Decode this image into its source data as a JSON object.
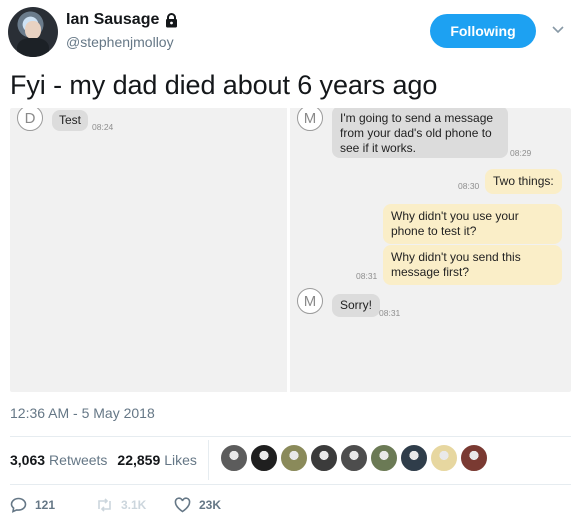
{
  "header": {
    "display_name": "Ian Sausage",
    "handle": "@stephenjmolloy",
    "follow_label": "Following",
    "follow_color": "#1da1f2",
    "lock_icon": "lock-icon",
    "menu_icon": "chevron-down-icon"
  },
  "tweet": {
    "text": "Fyi - my dad died about 6 years ago",
    "timestamp": "12:36 AM - 5 May 2018"
  },
  "media": {
    "left_panel": {
      "avatar_letter": "D",
      "message": "Test",
      "time": "08:24"
    },
    "right_panel": {
      "avatar_letter": "M",
      "incoming_1": "I'm going to send a message from your dad's old phone to see if it works.",
      "incoming_1_time": "08:29",
      "outgoing_1": "Two things:",
      "outgoing_1_time": "08:30",
      "outgoing_2": "Why didn't you use your phone to test it?",
      "outgoing_3": "Why didn't you send this message first?",
      "outgoing_3_time": "08:31",
      "incoming_2": "Sorry!",
      "incoming_2_time": "08:31"
    }
  },
  "stats": {
    "retweets_count": "3,063",
    "retweets_label": "Retweets",
    "likes_count": "22,859",
    "likes_label": "Likes",
    "likers": [
      "#5c5c5c",
      "#1f1f1f",
      "#8a8a5a",
      "#3b3b3b",
      "#4d4d4d",
      "#6b7a55",
      "#2f3d4a",
      "#e7d7a0",
      "#7a3a32"
    ]
  },
  "actions": {
    "reply_count": "121",
    "retweet_count": "3.1K",
    "like_count": "23K"
  }
}
